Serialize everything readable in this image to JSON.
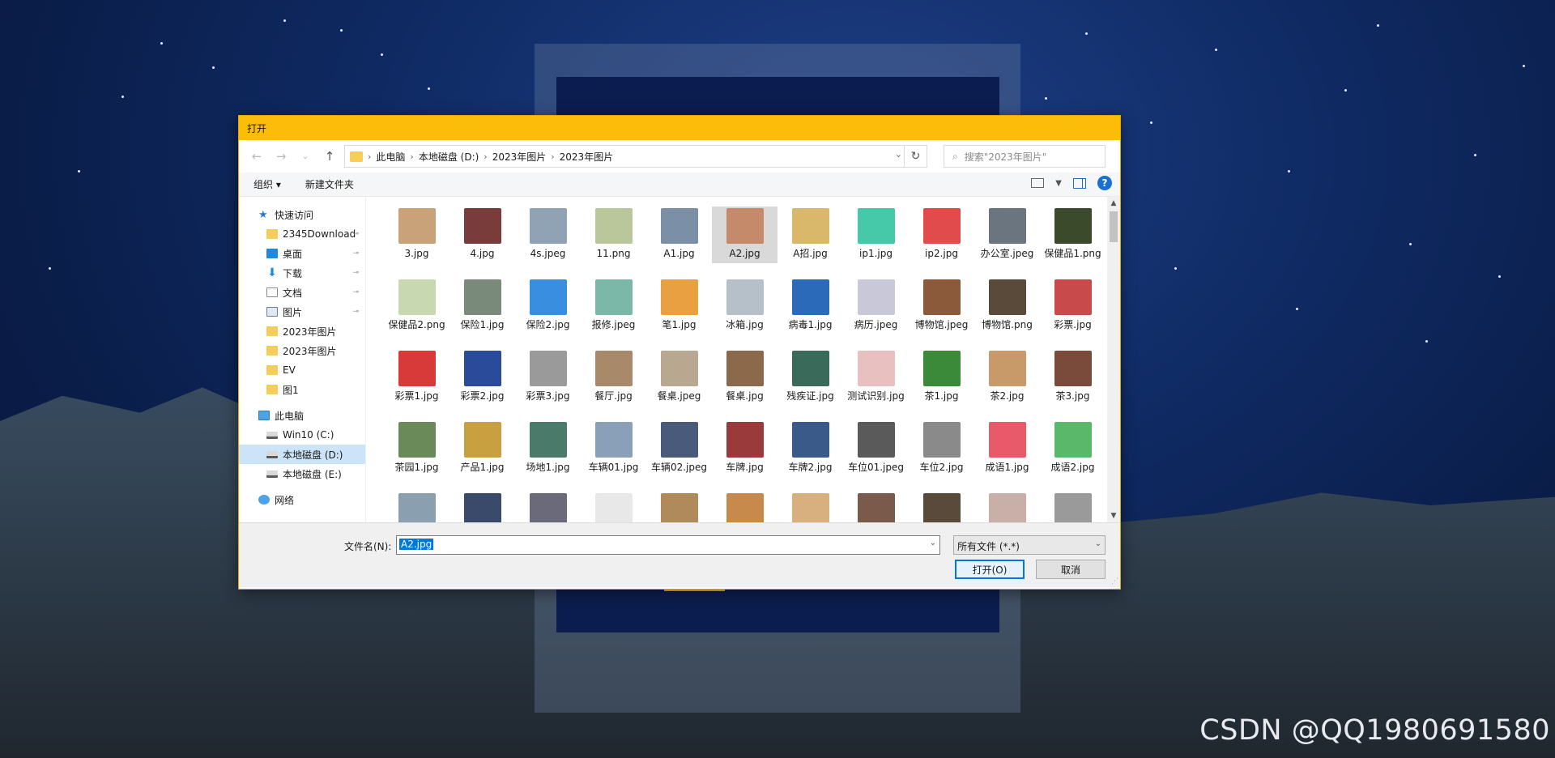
{
  "dialog": {
    "title": "打开",
    "breadcrumb": [
      "此电脑",
      "本地磁盘 (D:)",
      "2023年图片",
      "2023年图片"
    ],
    "search_placeholder": "搜索\"2023年图片\"",
    "toolbar": {
      "organize": "组织 ▾",
      "new_folder": "新建文件夹"
    },
    "sidebar": [
      {
        "label": "快速访问",
        "icon": "star-icon",
        "level": 0,
        "pinned": false
      },
      {
        "label": "2345Download",
        "icon": "folder-icon",
        "level": 1,
        "pinned": true
      },
      {
        "label": "桌面",
        "icon": "desktop-icon",
        "level": 1,
        "pinned": true
      },
      {
        "label": "下载",
        "icon": "download-icon",
        "level": 1,
        "pinned": true
      },
      {
        "label": "文档",
        "icon": "document-icon",
        "level": 1,
        "pinned": true
      },
      {
        "label": "图片",
        "icon": "pictures-icon",
        "level": 1,
        "pinned": true
      },
      {
        "label": "2023年图片",
        "icon": "folder-icon",
        "level": 1,
        "pinned": false
      },
      {
        "label": "2023年图片",
        "icon": "folder-icon",
        "level": 1,
        "pinned": false
      },
      {
        "label": "EV",
        "icon": "folder-icon",
        "level": 1,
        "pinned": false
      },
      {
        "label": "图1",
        "icon": "folder-icon",
        "level": 1,
        "pinned": false
      },
      {
        "label": "此电脑",
        "icon": "computer-icon",
        "level": 0,
        "pinned": false
      },
      {
        "label": "Win10 (C:)",
        "icon": "drive-icon",
        "level": 1,
        "pinned": false
      },
      {
        "label": "本地磁盘 (D:)",
        "icon": "drive-icon",
        "level": 1,
        "pinned": false,
        "selected": true
      },
      {
        "label": "本地磁盘 (E:)",
        "icon": "drive-icon",
        "level": 1,
        "pinned": false
      },
      {
        "label": "网络",
        "icon": "network-icon",
        "level": 0,
        "pinned": false
      }
    ],
    "files": [
      {
        "name": "3.jpg",
        "color": "#c9a27a"
      },
      {
        "name": "4.jpg",
        "color": "#7a3b3b"
      },
      {
        "name": "4s.jpeg",
        "color": "#8fa3b5"
      },
      {
        "name": "11.png",
        "color": "#b9c79a"
      },
      {
        "name": "A1.jpg",
        "color": "#7b8fa6"
      },
      {
        "name": "A2.jpg",
        "color": "#c58a6a",
        "selected": true
      },
      {
        "name": "A招.jpg",
        "color": "#d9b86b"
      },
      {
        "name": "ip1.jpg",
        "color": "#46c9a8"
      },
      {
        "name": "ip2.jpg",
        "color": "#e24b4b"
      },
      {
        "name": "办公室.jpeg",
        "color": "#6a7580"
      },
      {
        "name": "保健品1.png",
        "color": "#3a4a2a"
      },
      {
        "name": "保健品2.png",
        "color": "#c8d8b0"
      },
      {
        "name": "保险1.jpg",
        "color": "#7a8a7a"
      },
      {
        "name": "保险2.jpg",
        "color": "#3a8ee0"
      },
      {
        "name": "报修.jpeg",
        "color": "#7bb8a8"
      },
      {
        "name": "笔1.jpg",
        "color": "#e8a040"
      },
      {
        "name": "冰箱.jpg",
        "color": "#b5c0c8"
      },
      {
        "name": "病毒1.jpg",
        "color": "#2a6ab8"
      },
      {
        "name": "病历.jpeg",
        "color": "#c8c8d8"
      },
      {
        "name": "博物馆.jpeg",
        "color": "#8a5a3a"
      },
      {
        "name": "博物馆.png",
        "color": "#5a4a3a"
      },
      {
        "name": "彩票.jpg",
        "color": "#c84a4a"
      },
      {
        "name": "彩票1.jpg",
        "color": "#d83a3a"
      },
      {
        "name": "彩票2.jpg",
        "color": "#2a4a9a"
      },
      {
        "name": "彩票3.jpg",
        "color": "#9a9a9a"
      },
      {
        "name": "餐厅.jpg",
        "color": "#a88a6a"
      },
      {
        "name": "餐桌.jpeg",
        "color": "#b8a890"
      },
      {
        "name": "餐桌.jpg",
        "color": "#8a6a4a"
      },
      {
        "name": "残疾证.jpg",
        "color": "#3a6a5a"
      },
      {
        "name": "测试识别.jpg",
        "color": "#e8c0c0"
      },
      {
        "name": "茶1.jpg",
        "color": "#3a8a3a"
      },
      {
        "name": "茶2.jpg",
        "color": "#c89a6a"
      },
      {
        "name": "茶3.jpg",
        "color": "#7a4a3a"
      },
      {
        "name": "茶园1.jpg",
        "color": "#6a8a5a"
      },
      {
        "name": "产品1.jpg",
        "color": "#c8a040"
      },
      {
        "name": "场地1.jpg",
        "color": "#4a7a6a"
      },
      {
        "name": "车辆01.jpg",
        "color": "#8aa0b8"
      },
      {
        "name": "车辆02.jpeg",
        "color": "#4a5a7a"
      },
      {
        "name": "车牌.jpg",
        "color": "#9a3a3a"
      },
      {
        "name": "车牌2.jpg",
        "color": "#3a5a8a"
      },
      {
        "name": "车位01.jpeg",
        "color": "#5a5a5a"
      },
      {
        "name": "车位2.jpg",
        "color": "#8a8a8a"
      },
      {
        "name": "成语1.jpg",
        "color": "#e85a6a"
      },
      {
        "name": "成语2.jpg",
        "color": "#5ab86a"
      },
      {
        "name": "",
        "color": "#8aa0b0"
      },
      {
        "name": "",
        "color": "#3a4a6a"
      },
      {
        "name": "",
        "color": "#6a6a7a"
      },
      {
        "name": "",
        "color": "#e8e8e8"
      },
      {
        "name": "",
        "color": "#b08a5a"
      },
      {
        "name": "",
        "color": "#c88a4a"
      },
      {
        "name": "",
        "color": "#d8b080"
      },
      {
        "name": "",
        "color": "#7a5a4a"
      },
      {
        "name": "",
        "color": "#5a4a3a"
      },
      {
        "name": "",
        "color": "#c8b0a8"
      },
      {
        "name": "",
        "color": "#9a9a9a"
      }
    ],
    "footer": {
      "filename_label": "文件名(N):",
      "filename_value": "A2.jpg",
      "filetype_value": "所有文件 (*.*)",
      "open_label": "打开(O)",
      "cancel_label": "取消"
    }
  },
  "watermark": "CSDN @QQ1980691580"
}
